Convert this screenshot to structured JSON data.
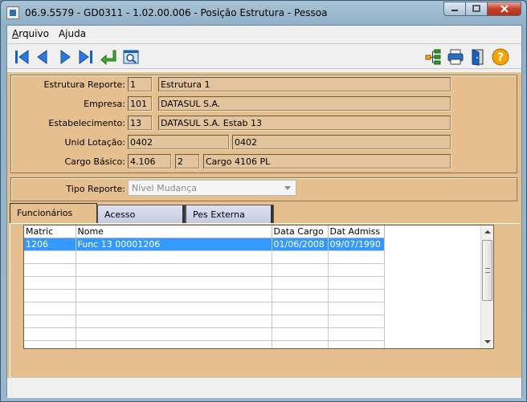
{
  "window": {
    "title": "06.9.5579 - GD0311 - 1.02.00.006 - Posição Estrutura - Pessoa"
  },
  "menu": [
    {
      "label": "Arquivo",
      "accel": "A",
      "rest": "rquivo"
    },
    {
      "label": "Ajuda",
      "accel": "j",
      "pre": "A",
      "rest": "uda"
    }
  ],
  "toolbar": {
    "left": [
      "first-record",
      "previous-record",
      "next-record",
      "last-record",
      "go-to-record",
      "search-record"
    ],
    "right": [
      "hierarchy",
      "print",
      "exit",
      "help"
    ]
  },
  "form": {
    "estrutura": {
      "label": "Estrutura Reporte:",
      "code": "1",
      "desc": "Estrutura 1"
    },
    "empresa": {
      "label": "Empresa:",
      "code": "101",
      "desc": "DATASUL S.A."
    },
    "estabelecimento": {
      "label": "Estabelecimento:",
      "code": "13",
      "desc": "DATASUL S.A. Estab 13"
    },
    "unid_lotacao": {
      "label": "Unid Lotação:",
      "code": "0402",
      "desc": "0402"
    },
    "cargo_basico": {
      "label": "Cargo Básico:",
      "code": "4.106",
      "seq": "2",
      "desc": "Cargo 4106 PL"
    },
    "tipo_reporte": {
      "label": "Tipo Reporte:",
      "value": "Nível Mudança"
    }
  },
  "tabs": [
    {
      "label": "Funcionários",
      "active": true
    },
    {
      "label": "Acesso",
      "active": false
    },
    {
      "label": "Pes Externa",
      "active": false
    }
  ],
  "grid": {
    "columns": [
      "Matric",
      "Nome",
      "Data Cargo",
      "Dat Admiss"
    ],
    "rows": [
      [
        "1206",
        "Func 13 00001206",
        "01/06/2008",
        "09/07/1990"
      ]
    ],
    "empty_rows": 8
  }
}
